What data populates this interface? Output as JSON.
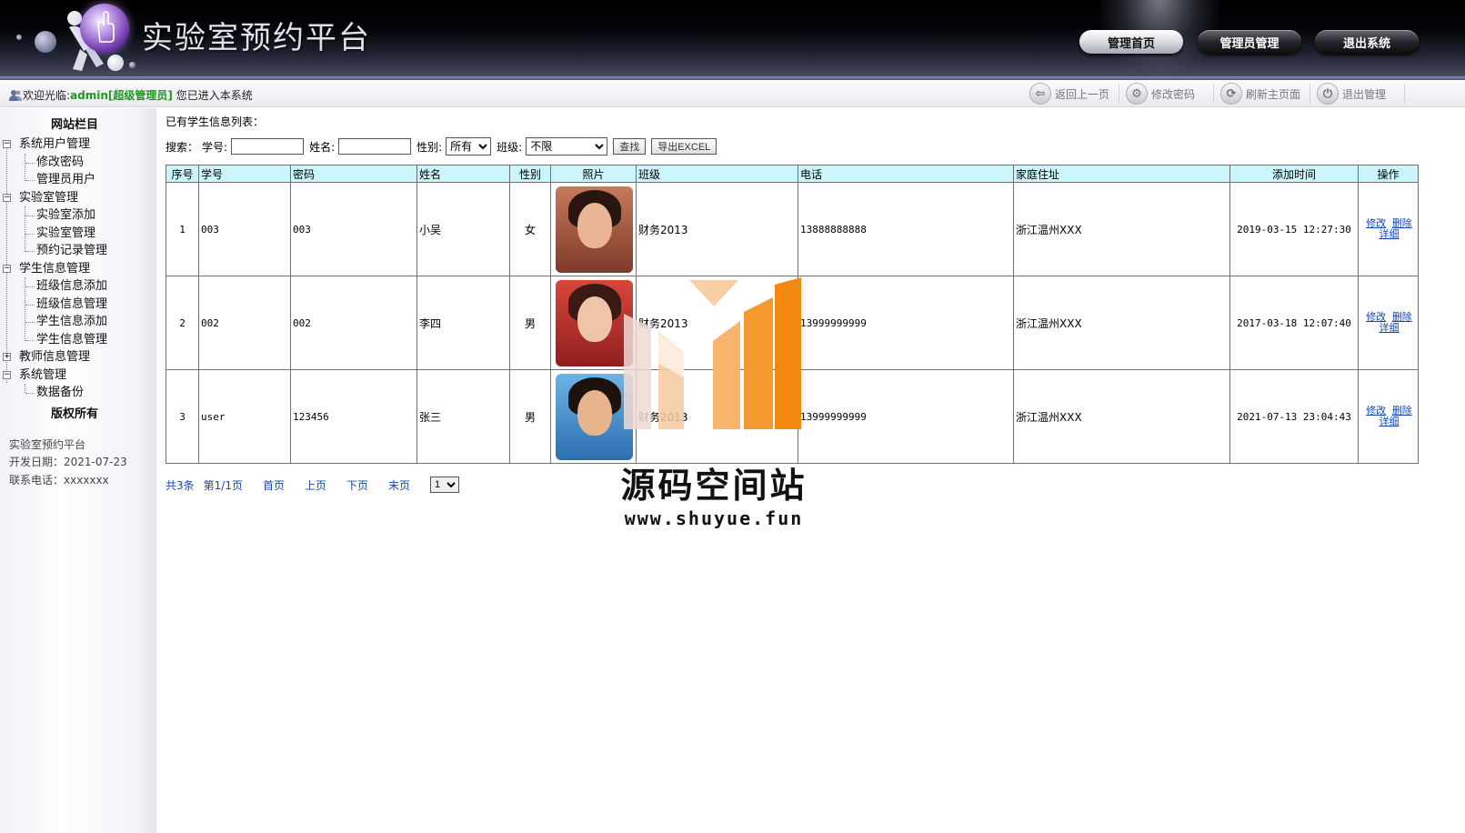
{
  "app": {
    "title": "实验室预约平台",
    "top_nav": [
      {
        "label": "管理首页",
        "active": true
      },
      {
        "label": "管理员管理",
        "active": false
      },
      {
        "label": "退出系统",
        "active": false
      }
    ]
  },
  "welcome": {
    "prefix": "欢迎光临:",
    "user": "admin[超级管理员]",
    "suffix": "您已进入本系统"
  },
  "toolbar": {
    "back": "返回上一页",
    "change_password": "修改密码",
    "refresh_home": "刷新主页面",
    "logout": "退出管理"
  },
  "sidebar": {
    "heading": "网站栏目",
    "groups": [
      {
        "label": "系统用户管理",
        "toggle": "−",
        "items": [
          "修改密码",
          "管理员用户"
        ]
      },
      {
        "label": "实验室管理",
        "toggle": "−",
        "items": [
          "实验室添加",
          "实验室管理",
          "预约记录管理"
        ]
      },
      {
        "label": "学生信息管理",
        "toggle": "−",
        "items": [
          "班级信息添加",
          "班级信息管理",
          "学生信息添加",
          "学生信息管理"
        ]
      },
      {
        "label": "教师信息管理",
        "toggle": "+",
        "items": []
      },
      {
        "label": "系统管理",
        "toggle": "−",
        "items": [
          "数据备份"
        ]
      }
    ],
    "copyright": "版权所有",
    "info": {
      "name": "实验室预约平台",
      "date": "开发日期：2021-07-23",
      "phone": "联系电话：xxxxxxx"
    }
  },
  "main": {
    "list_title": "已有学生信息列表：",
    "search": {
      "label": "搜索：",
      "student_no_label": "学号:",
      "student_no_value": "",
      "name_label": "姓名:",
      "name_value": "",
      "gender_label": "性别:",
      "gender_selected": "所有",
      "class_label": "班级:",
      "class_selected": "不限",
      "search_button": "查找",
      "export_button": "导出EXCEL"
    },
    "table": {
      "columns": [
        "序号",
        "学号",
        "密码",
        "姓名",
        "性别",
        "照片",
        "班级",
        "电话",
        "家庭住址",
        "添加时间",
        "操作"
      ],
      "rows": [
        {
          "index": "1",
          "student_no": "003",
          "password": "003",
          "name": "小吴",
          "gender": "女",
          "class": "财务2013",
          "phone": "13888888888",
          "address": "浙江温州XXX",
          "added": "2019-03-15 12:27:30"
        },
        {
          "index": "2",
          "student_no": "002",
          "password": "002",
          "name": "李四",
          "gender": "男",
          "class": "财务2013",
          "phone": "13999999999",
          "address": "浙江温州XXX",
          "added": "2017-03-18 12:07:40"
        },
        {
          "index": "3",
          "student_no": "user",
          "password": "123456",
          "name": "张三",
          "gender": "男",
          "class": "财务2013",
          "phone": "13999999999",
          "address": "浙江温州XXX",
          "added": "2021-07-13 23:04:43"
        }
      ],
      "ops": {
        "edit": "修改",
        "delete": "删除",
        "detail": "详细"
      }
    },
    "pager": {
      "total": "共3条",
      "page_info": "第1/1页",
      "first": "首页",
      "prev": "上页",
      "next": "下页",
      "last": "末页",
      "page_selected": "1"
    }
  },
  "watermark": {
    "text": "源码空间站",
    "url": "www.shuyue.fun"
  }
}
